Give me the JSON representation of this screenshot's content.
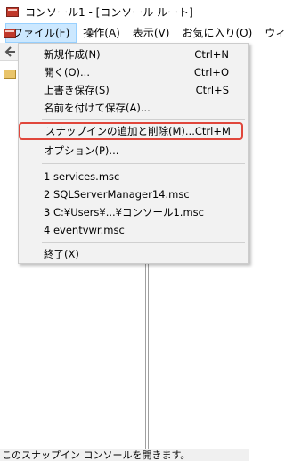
{
  "window": {
    "title": "コンソール1 - [コンソール ルート]"
  },
  "menubar": {
    "items": [
      {
        "label": "ファイル(F)"
      },
      {
        "label": "操作(A)"
      },
      {
        "label": "表示(V)"
      },
      {
        "label": "お気に入り(O)"
      },
      {
        "label": "ウィ"
      }
    ]
  },
  "file_menu": {
    "new": {
      "label": "新規作成(N)",
      "shortcut": "Ctrl+N"
    },
    "open": {
      "label": "開く(O)...",
      "shortcut": "Ctrl+O"
    },
    "save": {
      "label": "上書き保存(S)",
      "shortcut": "Ctrl+S"
    },
    "save_as": {
      "label": "名前を付けて保存(A)..."
    },
    "add_remove_snapin": {
      "label": "スナップインの追加と削除(M)...",
      "shortcut": "Ctrl+M"
    },
    "options": {
      "label": "オプション(P)..."
    },
    "recent": [
      {
        "label": "1 services.msc"
      },
      {
        "label": "2 SQLServerManager14.msc"
      },
      {
        "label": "3 C:¥Users¥...¥コンソール1.msc"
      },
      {
        "label": "4 eventvwr.msc"
      }
    ],
    "exit": {
      "label": "終了(X)"
    }
  },
  "statusbar": {
    "text": "このスナップイン コンソールを開きます。"
  }
}
